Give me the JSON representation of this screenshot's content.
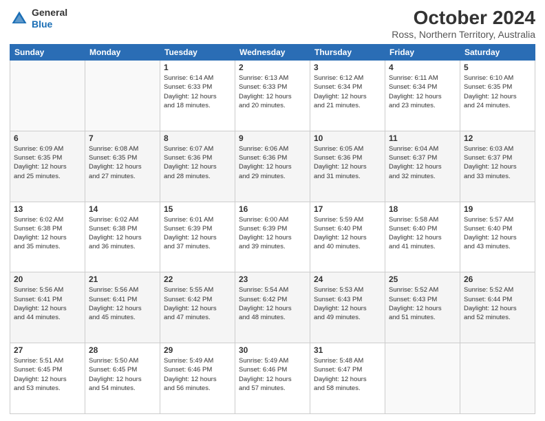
{
  "header": {
    "logo_line1": "General",
    "logo_line2": "Blue",
    "title": "October 2024",
    "subtitle": "Ross, Northern Territory, Australia"
  },
  "calendar": {
    "columns": [
      "Sunday",
      "Monday",
      "Tuesday",
      "Wednesday",
      "Thursday",
      "Friday",
      "Saturday"
    ],
    "rows": [
      [
        {
          "day": "",
          "info": ""
        },
        {
          "day": "",
          "info": ""
        },
        {
          "day": "1",
          "info": "Sunrise: 6:14 AM\nSunset: 6:33 PM\nDaylight: 12 hours\nand 18 minutes."
        },
        {
          "day": "2",
          "info": "Sunrise: 6:13 AM\nSunset: 6:33 PM\nDaylight: 12 hours\nand 20 minutes."
        },
        {
          "day": "3",
          "info": "Sunrise: 6:12 AM\nSunset: 6:34 PM\nDaylight: 12 hours\nand 21 minutes."
        },
        {
          "day": "4",
          "info": "Sunrise: 6:11 AM\nSunset: 6:34 PM\nDaylight: 12 hours\nand 23 minutes."
        },
        {
          "day": "5",
          "info": "Sunrise: 6:10 AM\nSunset: 6:35 PM\nDaylight: 12 hours\nand 24 minutes."
        }
      ],
      [
        {
          "day": "6",
          "info": "Sunrise: 6:09 AM\nSunset: 6:35 PM\nDaylight: 12 hours\nand 25 minutes."
        },
        {
          "day": "7",
          "info": "Sunrise: 6:08 AM\nSunset: 6:35 PM\nDaylight: 12 hours\nand 27 minutes."
        },
        {
          "day": "8",
          "info": "Sunrise: 6:07 AM\nSunset: 6:36 PM\nDaylight: 12 hours\nand 28 minutes."
        },
        {
          "day": "9",
          "info": "Sunrise: 6:06 AM\nSunset: 6:36 PM\nDaylight: 12 hours\nand 29 minutes."
        },
        {
          "day": "10",
          "info": "Sunrise: 6:05 AM\nSunset: 6:36 PM\nDaylight: 12 hours\nand 31 minutes."
        },
        {
          "day": "11",
          "info": "Sunrise: 6:04 AM\nSunset: 6:37 PM\nDaylight: 12 hours\nand 32 minutes."
        },
        {
          "day": "12",
          "info": "Sunrise: 6:03 AM\nSunset: 6:37 PM\nDaylight: 12 hours\nand 33 minutes."
        }
      ],
      [
        {
          "day": "13",
          "info": "Sunrise: 6:02 AM\nSunset: 6:38 PM\nDaylight: 12 hours\nand 35 minutes."
        },
        {
          "day": "14",
          "info": "Sunrise: 6:02 AM\nSunset: 6:38 PM\nDaylight: 12 hours\nand 36 minutes."
        },
        {
          "day": "15",
          "info": "Sunrise: 6:01 AM\nSunset: 6:39 PM\nDaylight: 12 hours\nand 37 minutes."
        },
        {
          "day": "16",
          "info": "Sunrise: 6:00 AM\nSunset: 6:39 PM\nDaylight: 12 hours\nand 39 minutes."
        },
        {
          "day": "17",
          "info": "Sunrise: 5:59 AM\nSunset: 6:40 PM\nDaylight: 12 hours\nand 40 minutes."
        },
        {
          "day": "18",
          "info": "Sunrise: 5:58 AM\nSunset: 6:40 PM\nDaylight: 12 hours\nand 41 minutes."
        },
        {
          "day": "19",
          "info": "Sunrise: 5:57 AM\nSunset: 6:40 PM\nDaylight: 12 hours\nand 43 minutes."
        }
      ],
      [
        {
          "day": "20",
          "info": "Sunrise: 5:56 AM\nSunset: 6:41 PM\nDaylight: 12 hours\nand 44 minutes."
        },
        {
          "day": "21",
          "info": "Sunrise: 5:56 AM\nSunset: 6:41 PM\nDaylight: 12 hours\nand 45 minutes."
        },
        {
          "day": "22",
          "info": "Sunrise: 5:55 AM\nSunset: 6:42 PM\nDaylight: 12 hours\nand 47 minutes."
        },
        {
          "day": "23",
          "info": "Sunrise: 5:54 AM\nSunset: 6:42 PM\nDaylight: 12 hours\nand 48 minutes."
        },
        {
          "day": "24",
          "info": "Sunrise: 5:53 AM\nSunset: 6:43 PM\nDaylight: 12 hours\nand 49 minutes."
        },
        {
          "day": "25",
          "info": "Sunrise: 5:52 AM\nSunset: 6:43 PM\nDaylight: 12 hours\nand 51 minutes."
        },
        {
          "day": "26",
          "info": "Sunrise: 5:52 AM\nSunset: 6:44 PM\nDaylight: 12 hours\nand 52 minutes."
        }
      ],
      [
        {
          "day": "27",
          "info": "Sunrise: 5:51 AM\nSunset: 6:45 PM\nDaylight: 12 hours\nand 53 minutes."
        },
        {
          "day": "28",
          "info": "Sunrise: 5:50 AM\nSunset: 6:45 PM\nDaylight: 12 hours\nand 54 minutes."
        },
        {
          "day": "29",
          "info": "Sunrise: 5:49 AM\nSunset: 6:46 PM\nDaylight: 12 hours\nand 56 minutes."
        },
        {
          "day": "30",
          "info": "Sunrise: 5:49 AM\nSunset: 6:46 PM\nDaylight: 12 hours\nand 57 minutes."
        },
        {
          "day": "31",
          "info": "Sunrise: 5:48 AM\nSunset: 6:47 PM\nDaylight: 12 hours\nand 58 minutes."
        },
        {
          "day": "",
          "info": ""
        },
        {
          "day": "",
          "info": ""
        }
      ]
    ]
  }
}
